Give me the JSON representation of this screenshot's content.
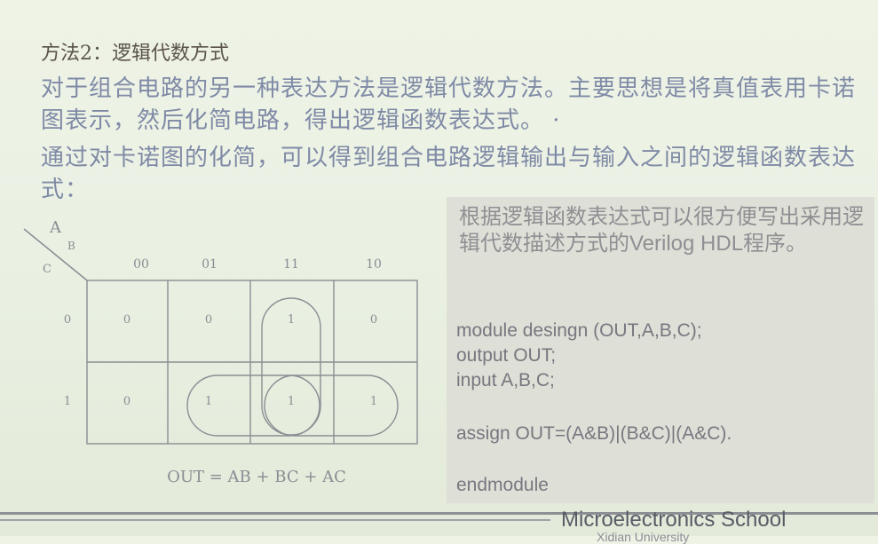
{
  "slide": {
    "title": "方法2：逻辑代数方式",
    "paragraph1": "对于组合电路的另一种表达方法是逻辑代数方法。主要思想是将真值表用卡诺图表示，然后化简电路，得出逻辑函数表达式。 ·",
    "paragraph2": "通过对卡诺图的化简，可以得到组合电路逻辑输出与输入之间的逻辑函数表达式："
  },
  "kmap": {
    "var_a": "A",
    "var_b": "B",
    "var_c": "C",
    "col_headers": [
      "00",
      "01",
      "11",
      "10"
    ],
    "row_headers": [
      "0",
      "1"
    ],
    "cells": [
      [
        "0",
        "0",
        "1",
        "0"
      ],
      [
        "0",
        "1",
        "1",
        "1"
      ]
    ],
    "equation": "OUT = AB + BC + AC"
  },
  "code_panel": {
    "intro": "根据逻辑函数表达式可以很方便写出采用逻辑代数描述方式的Verilog HDL程序。",
    "lines": [
      "module desingn (OUT,A,B,C);",
      "output OUT;",
      "input A,B,C;",
      "assign OUT=(A&B)|(B&C)|(A&C).",
      "endmodule"
    ]
  },
  "footer": {
    "school": "Microelectronics School",
    "sub": "Xidian University"
  }
}
